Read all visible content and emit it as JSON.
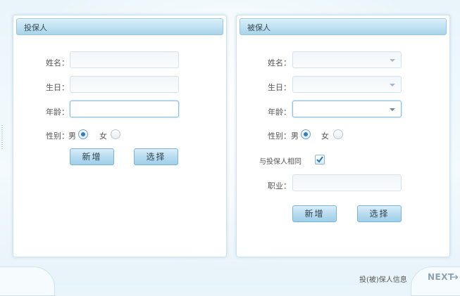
{
  "left_panel": {
    "title": "投保人",
    "name_label": "姓名：",
    "birthday_label": "生日：",
    "age_label": "年龄：",
    "gender_label": "性别：",
    "gender_male": "男",
    "gender_female": "女",
    "gender_selected": "男",
    "add_button": "新增",
    "select_button": "选择"
  },
  "right_panel": {
    "title": "被保人",
    "name_label": "姓名：",
    "birthday_label": "生日：",
    "age_label": "年龄：",
    "gender_label": "性别：",
    "gender_male": "男",
    "gender_female": "女",
    "gender_selected": "男",
    "same_as_label": "与投保人相同",
    "same_as_checked": true,
    "occupation_label": "职业：",
    "add_button": "新增",
    "select_button": "选择"
  },
  "footer": {
    "page_label": "投(被)保人信息",
    "next_label": "NEXT",
    "next_arrow_icon": "arrow-right-icon"
  }
}
